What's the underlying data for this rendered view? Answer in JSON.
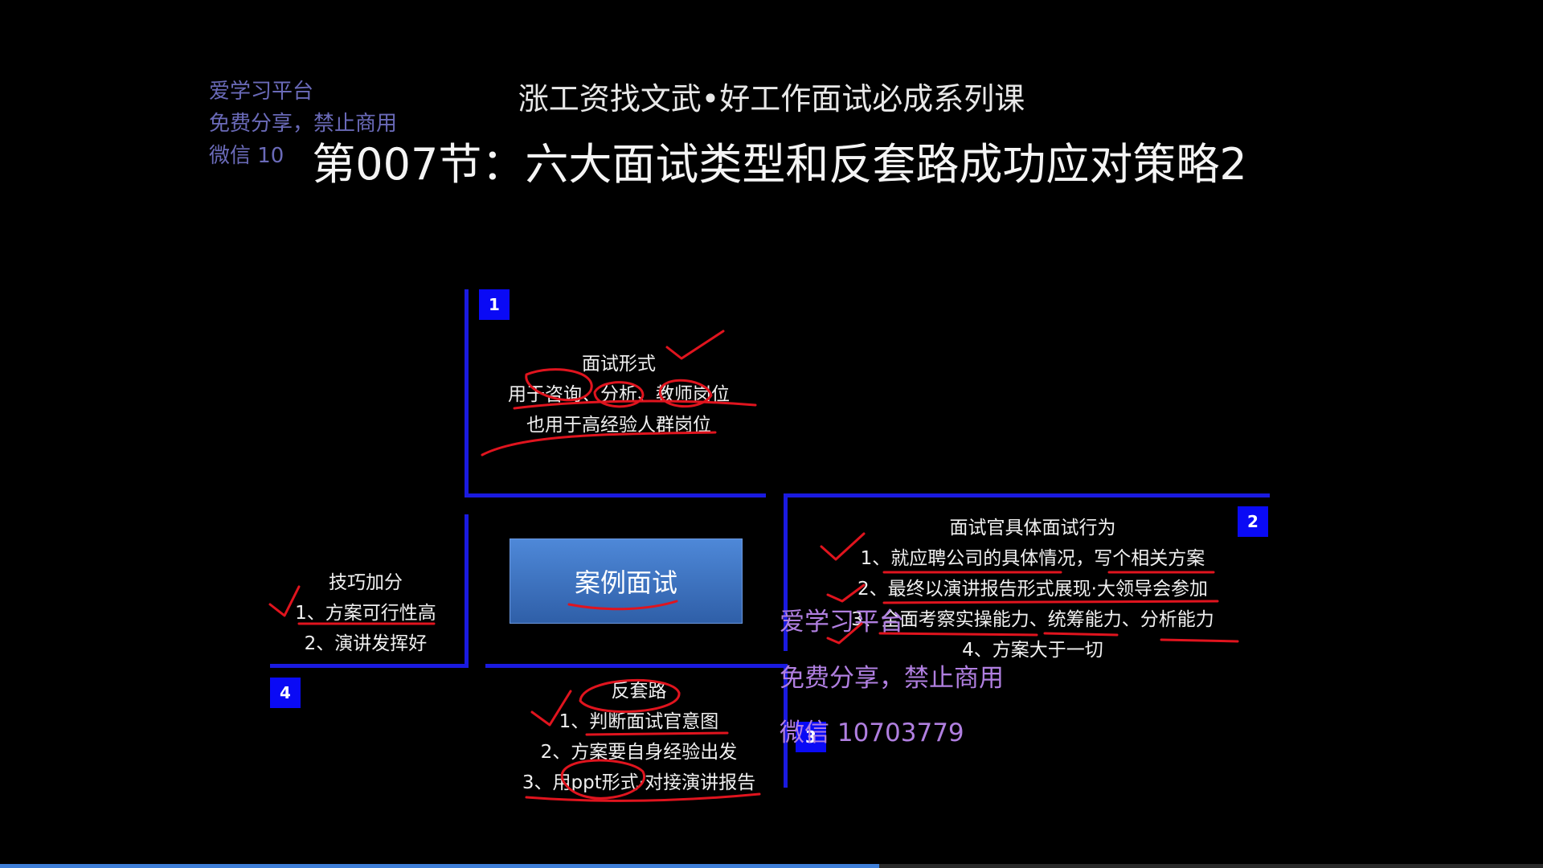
{
  "slide": {
    "subtitle": "涨工资找文武•好工作面试必成系列课",
    "title": "第007节：六大面试类型和反套路成功应对策略2"
  },
  "watermark_top": {
    "line1": "爱学习平台",
    "line2": "免费分享，禁止商用",
    "line3": "微信 10"
  },
  "watermark_mid": {
    "line1": "爱学习平台",
    "line2": "免费分享，禁止商用",
    "line3": "微信 10703779"
  },
  "center": {
    "label": "案例面试"
  },
  "quadrants": {
    "q1": {
      "badge": "1",
      "heading": "面试形式",
      "lines": [
        "用于咨询、分析、教师岗位",
        "也用于高经验人群岗位"
      ]
    },
    "q2": {
      "badge": "2",
      "heading": "面试官具体面试行为",
      "lines": [
        "1、就应聘公司的具体情况，写个相关方案",
        "2、最终以演讲报告形式展现·大领导会参加",
        "3、全面考察实操能力、统筹能力、分析能力",
        "4、方案大于一切"
      ]
    },
    "q3": {
      "badge": "3",
      "heading": "反套路",
      "lines": [
        "1、判断面试官意图",
        "2、方案要自身经验出发",
        "3、用ppt形式·对接演讲报告"
      ]
    },
    "q4": {
      "badge": "4",
      "heading": "技巧加分",
      "lines": [
        "1、方案可行性高",
        "2、演讲发挥好"
      ]
    }
  },
  "colors": {
    "background": "#000000",
    "divider": "#1a1ae0",
    "badge": "#0a0af5",
    "annotation": "#e0141e",
    "watermark_top": "#6a6ab8",
    "watermark_mid": "#b07fe0",
    "button": "#3f73c4"
  },
  "playback": {
    "progress": 0.57
  }
}
